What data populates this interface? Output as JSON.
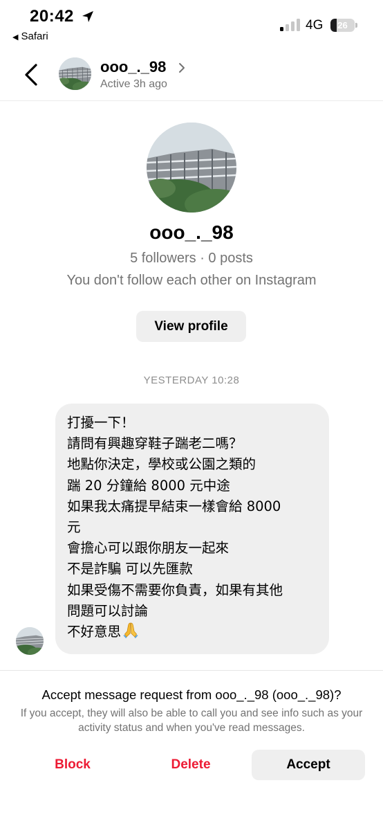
{
  "status_bar": {
    "time": "20:42",
    "back_app": "Safari",
    "network": "4G",
    "battery_level": "26",
    "battery_fraction": 0.26,
    "icons": [
      "location-arrow-icon",
      "signal-bars-icon",
      "battery-icon"
    ]
  },
  "header": {
    "username": "ooo_._98",
    "active_status": "Active 3h ago"
  },
  "profile": {
    "username": "ooo_._98",
    "stats": "5 followers · 0 posts",
    "follow_status": "You don't follow each other on Instagram",
    "view_profile_label": "View profile"
  },
  "conversation": {
    "timestamp": "YESTERDAY 10:28",
    "message_lines": [
      "打擾一下！",
      "請問有興趣穿鞋子踹老二嗎？",
      "地點你決定，學校或公園之類的",
      "踹 20 分鐘給 8000 元中途",
      "如果我太痛提早結束一樣會給 8000",
      "元",
      "會擔心可以跟你朋友一起來",
      "不是詐騙 可以先匯款",
      "如果受傷不需要你負責，如果有其他",
      "問題可以討論",
      "不好意思"
    ],
    "message_end_emoji": "folded-hands-emoji"
  },
  "request": {
    "title": "Accept message request from ooo_._98 (ooo_._98)?",
    "description": "If you accept, they will also be able to call you and see info such as your activity status and when you've read messages.",
    "block_label": "Block",
    "delete_label": "Delete",
    "accept_label": "Accept"
  },
  "colors": {
    "destructive": "#ed1b34",
    "secondary_text": "#737373",
    "bubble_bg": "#efefef",
    "button_bg": "#efefef"
  }
}
